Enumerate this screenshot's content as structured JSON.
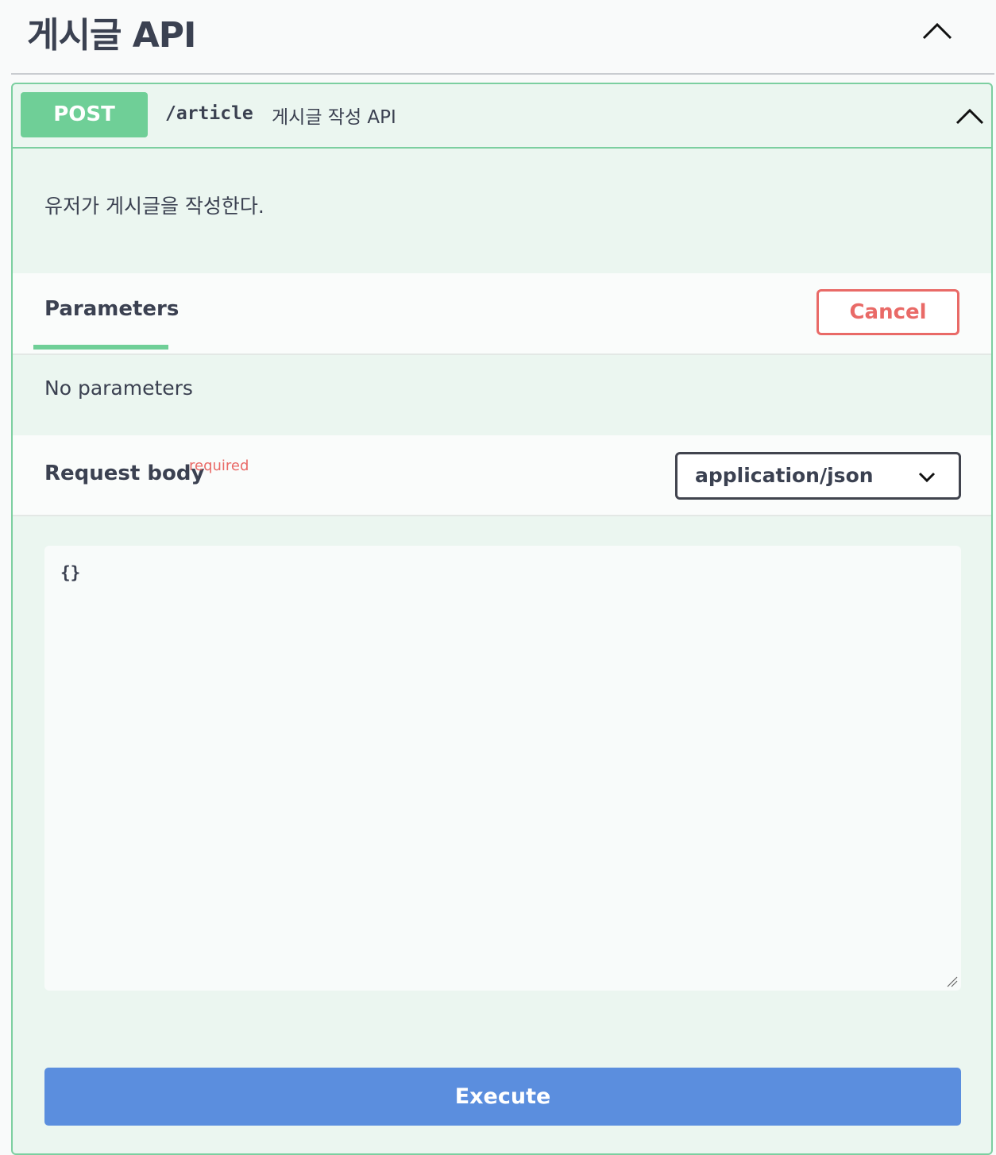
{
  "section": {
    "title": "게시글 API",
    "toggle_icon": "chevron-up-icon"
  },
  "operation": {
    "method": "POST",
    "method_color": "#6fcf97",
    "path": "/article",
    "summary": "게시글 작성 API",
    "toggle_icon": "chevron-up-icon",
    "description": "유저가 게시글을 작성한다."
  },
  "parameters": {
    "tab_label": "Parameters",
    "cancel_label": "Cancel",
    "empty_text": "No parameters"
  },
  "request_body": {
    "title": "Request body",
    "required_label": "required",
    "content_type": "application/json",
    "body_value": "{}"
  },
  "actions": {
    "execute_label": "Execute",
    "execute_color": "#5b8ede"
  }
}
